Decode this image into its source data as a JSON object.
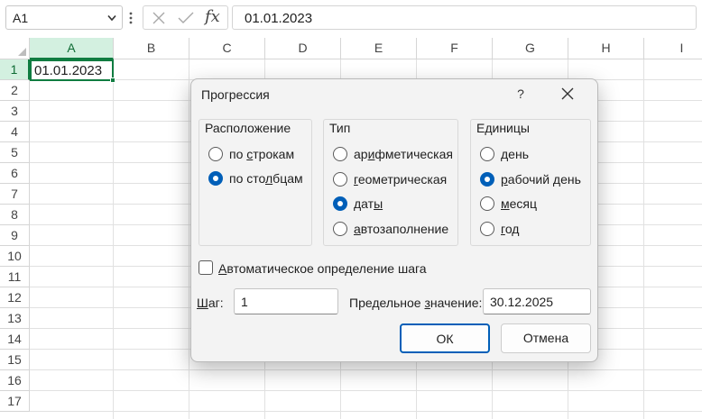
{
  "formula_bar": {
    "name_box": "A1",
    "fx_label": "fx",
    "formula_value": "01.01.2023"
  },
  "sheet": {
    "columns": [
      "A",
      "B",
      "C",
      "D",
      "E",
      "F",
      "G",
      "H",
      "I"
    ],
    "rows": [
      "1",
      "2",
      "3",
      "4",
      "5",
      "6",
      "7",
      "8",
      "9",
      "10",
      "11",
      "12",
      "13",
      "14",
      "15",
      "16",
      "17"
    ],
    "selected_cell": "A1",
    "a1_value": "01.01.2023",
    "accent_color": "#107c41"
  },
  "dialog": {
    "title": "Прогрессия",
    "help": "?",
    "location": {
      "title": "Расположение",
      "options": [
        {
          "pre": "по ",
          "key": "с",
          "post": "трокам",
          "checked": false
        },
        {
          "pre": "по сто",
          "key": "л",
          "post": "бцам",
          "checked": true
        }
      ]
    },
    "type": {
      "title": "Тип",
      "options": [
        {
          "pre": "ар",
          "key": "и",
          "post": "фметическая",
          "checked": false
        },
        {
          "pre": "",
          "key": "г",
          "post": "еометрическая",
          "checked": false
        },
        {
          "pre": "дат",
          "key": "ы",
          "post": "",
          "checked": true
        },
        {
          "pre": "",
          "key": "а",
          "post": "втозаполнение",
          "checked": false
        }
      ]
    },
    "units": {
      "title": "Единицы",
      "options": [
        {
          "pre": "",
          "key": "д",
          "post": "ень",
          "checked": false
        },
        {
          "pre": "",
          "key": "р",
          "post": "абочий день",
          "checked": true
        },
        {
          "pre": "",
          "key": "м",
          "post": "есяц",
          "checked": false
        },
        {
          "pre": "",
          "key": "г",
          "post": "од",
          "checked": false
        }
      ]
    },
    "auto_step": {
      "pre": "",
      "key": "А",
      "post": "втоматическое определение шага",
      "checked": false
    },
    "step": {
      "pre": "",
      "key": "Ш",
      "post": "аг:",
      "value": "1"
    },
    "limit": {
      "pre": "Предельное ",
      "key": "з",
      "post": "начение:",
      "value": "30.12.2025"
    },
    "ok_label": "ОК",
    "cancel_label": "Отмена",
    "accent_color": "#005fb8"
  }
}
